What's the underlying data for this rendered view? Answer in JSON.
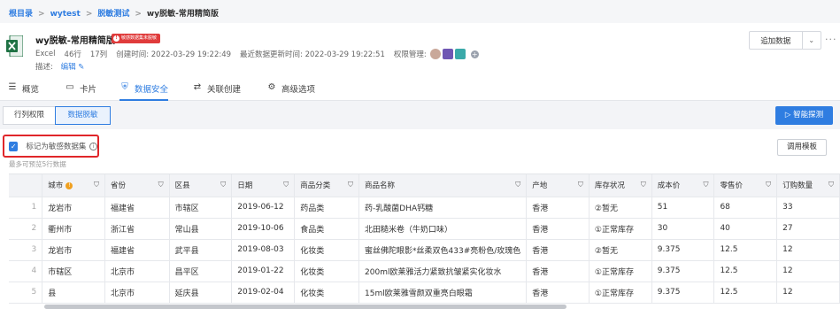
{
  "breadcrumb": {
    "items": [
      "根目录",
      "wytest",
      "脱敏测试"
    ],
    "current": "wy脱敏-常用精简版",
    "separator": ">"
  },
  "header": {
    "title": "wy脱敏-常用精简版",
    "badge": "敏感数据集未脱敏",
    "badge_icon": "!",
    "type": "Excel",
    "rows": "46行",
    "cols": "17列",
    "created": "创建时间: 2022-03-29 19:22:49",
    "updated": "最近数据更新时间: 2022-03-29 19:22:51",
    "permission_label": "权限管理:",
    "desc_label": "描述:",
    "edit_label": "编辑",
    "add_data_label": "追加数据",
    "more": "···"
  },
  "tabs": [
    {
      "label": "概览",
      "icon": "☰"
    },
    {
      "label": "卡片",
      "icon": "▭"
    },
    {
      "label": "数据安全",
      "icon": "⛨"
    },
    {
      "label": "关联创建",
      "icon": "⇄"
    },
    {
      "label": "高级选项",
      "icon": "⚙"
    }
  ],
  "subtabs": [
    "行列权限",
    "数据脱敏"
  ],
  "smart_detect": "智能探测",
  "sensitive": {
    "label": "标记为敏感数据集",
    "checked": true,
    "info": "i"
  },
  "preview_note": "最多可预览5行数据",
  "template_button": "调用模板",
  "table": {
    "columns": [
      "城市",
      "省份",
      "区县",
      "日期",
      "商品分类",
      "商品名称",
      "产地",
      "库存状况",
      "成本价",
      "零售价",
      "订购数量"
    ],
    "rows": [
      [
        "1",
        "龙岩市",
        "福建省",
        "市辖区",
        "2019-06-12",
        "药品类",
        "药-乳酸菌DHA钙糖",
        "香港",
        "②暂无",
        "51",
        "68",
        "33"
      ],
      [
        "2",
        "衢州市",
        "浙江省",
        "常山县",
        "2019-10-06",
        "食品类",
        "北田糙米卷（牛奶口味）",
        "香港",
        "①正常库存",
        "30",
        "40",
        "27"
      ],
      [
        "3",
        "龙岩市",
        "福建省",
        "武平县",
        "2019-08-03",
        "化妆类",
        "蜜丝佛陀眼影*丝柔双色433#亮粉色/玫瑰色",
        "香港",
        "②暂无",
        "9.375",
        "12.5",
        "12"
      ],
      [
        "4",
        "市辖区",
        "北京市",
        "昌平区",
        "2019-01-22",
        "化妆类",
        "200ml欧莱雅活力紧致抗皱紧实化妆水",
        "香港",
        "①正常库存",
        "9.375",
        "12.5",
        "12"
      ],
      [
        "5",
        "县",
        "北京市",
        "延庆县",
        "2019-02-04",
        "化妆类",
        "15ml欧莱雅雪颜双重亮白眼霜",
        "香港",
        "①正常库存",
        "9.375",
        "12.5",
        "12"
      ]
    ]
  },
  "colors": {
    "accent": "#2f7de1",
    "danger": "#e0262a",
    "excel": "#1f7244"
  }
}
